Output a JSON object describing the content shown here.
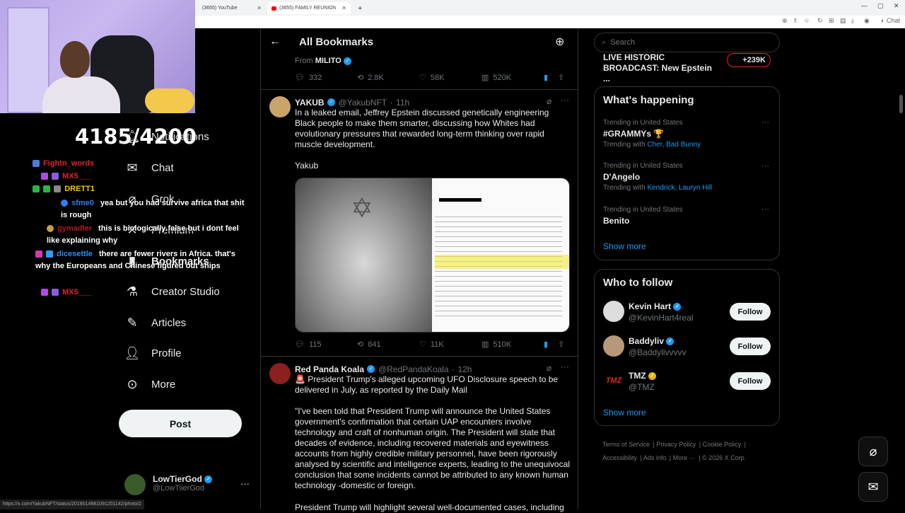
{
  "browser": {
    "tabs": [
      {
        "title": "(3655) YouTube"
      },
      {
        "title": "(3655) FAMILY REUNION | BBQ | G"
      }
    ],
    "status_url": "https://x.com/YakubNFT/status/2018014981091201142/photo/2"
  },
  "overlay": {
    "counter": "4185/4200",
    "chat": [
      {
        "user": "Fightn_words",
        "user_color": "#e0252b",
        "message": ""
      },
      {
        "user": "MX5___",
        "user_color": "#e0252b",
        "message": ""
      },
      {
        "user": "DRETT1",
        "user_color": "#f0c419",
        "message": ""
      },
      {
        "user": "sfme0",
        "user_color": "#2f7ff0",
        "message": "yea but you had survive africa that shit is rough"
      },
      {
        "user": "gymadler",
        "user_color": "#b01e1e",
        "message": "this is biologically false but i dont feel like explaining why"
      },
      {
        "user": "dicesettle",
        "user_color": "#2d8ef0",
        "message": "there are fewer rivers in Africa. that's why the Europeans and Chinese figured out ships"
      },
      {
        "user": "MX5___",
        "user_color": "#e0252b",
        "message": ""
      }
    ]
  },
  "nav": {
    "items": [
      {
        "label": "Notifications",
        "icon": "bell-icon"
      },
      {
        "label": "Chat",
        "icon": "mail-icon"
      },
      {
        "label": "Grok",
        "icon": "grok-icon"
      },
      {
        "label": "Premium",
        "icon": "x-icon"
      },
      {
        "label": "Bookmarks",
        "icon": "bookmark-icon"
      },
      {
        "label": "Creator Studio",
        "icon": "flask-icon"
      },
      {
        "label": "Articles",
        "icon": "article-icon"
      },
      {
        "label": "Profile",
        "icon": "person-icon"
      },
      {
        "label": "More",
        "icon": "more-circle-icon"
      }
    ],
    "post_label": "Post",
    "account": {
      "name": "LowTierGod",
      "handle": "@LowTiierGod"
    }
  },
  "feed": {
    "header_title": "All Bookmarks",
    "prev_tweet": {
      "from_label": "From",
      "from_name": "MILITO",
      "replies": "332",
      "reposts": "2.8K",
      "likes": "58K",
      "views": "520K"
    },
    "tweets": [
      {
        "name": "YAKUB",
        "handle": "@YakubNFT",
        "time": "11h",
        "text": "In a leaked email, Jeffrey Epstein discussed genetically engineering Black people to make them smarter, discussing how Whites had evolutionary pressures that rewarded long-term thinking over rapid muscle development.",
        "signature": "Yakub",
        "replies": "115",
        "reposts": "841",
        "likes": "11K",
        "views": "510K"
      },
      {
        "name": "Red Panda Koala",
        "handle": "@RedPandaKoala",
        "time": "12h",
        "text": "🚨 President Trump's alleged upcoming UFO Disclosure speech to be delivered in July, as reported by the Daily Mail",
        "quote": "\"I've been told that President Trump will announce the United States government's confirmation that certain UAP encounters involve technology and craft of nonhuman origin. The President will state that decades of evidence, including recovered materials and eyewitness accounts from highly credible military personnel, have been rigorously analysed by scientific and intelligence experts, leading to the unequivocal conclusion that some incidents cannot be attributed to any known human technology -domestic or foreign.",
        "cutoff": "President Trump will highlight several well-documented cases, including"
      }
    ]
  },
  "sidebar": {
    "search_placeholder": "Search",
    "live": {
      "title": "LIVE HISTORIC BROADCAST: New Epstein ...",
      "count": "+239K"
    },
    "happening": {
      "title": "What's happening",
      "trends": [
        {
          "meta": "Trending in United States",
          "title": "#GRAMMYs 🏆",
          "with_label": "Trending with",
          "with": "Cher, Bad Bunny"
        },
        {
          "meta": "Trending in United States",
          "title": "D'Angelo",
          "with_label": "Trending with",
          "with": "Kendrick, Lauryn Hill"
        },
        {
          "meta": "Trending in United States",
          "title": "Benito",
          "with_label": "",
          "with": ""
        }
      ],
      "show_more": "Show more"
    },
    "who_to_follow": {
      "title": "Who to follow",
      "accounts": [
        {
          "name": "Kevin Hart",
          "handle": "@KevinHart4real",
          "badge_color": "#1d9bf0"
        },
        {
          "name": "Baddyliv",
          "handle": "@Baddylivvvvv",
          "badge_color": "#1d9bf0"
        },
        {
          "name": "TMZ",
          "handle": "@TMZ",
          "badge_color": "#e2b719"
        }
      ],
      "follow_label": "Follow",
      "show_more": "Show more"
    },
    "footer": {
      "links": [
        "Terms of Service",
        "Privacy Policy",
        "Cookie Policy",
        "Accessibility",
        "Ads info",
        "More ···"
      ],
      "copyright": "© 2026 X Corp."
    }
  },
  "colors": {
    "accent": "#1d9bf0",
    "background": "#000000",
    "border": "#2f3336",
    "muted": "#71767b"
  }
}
